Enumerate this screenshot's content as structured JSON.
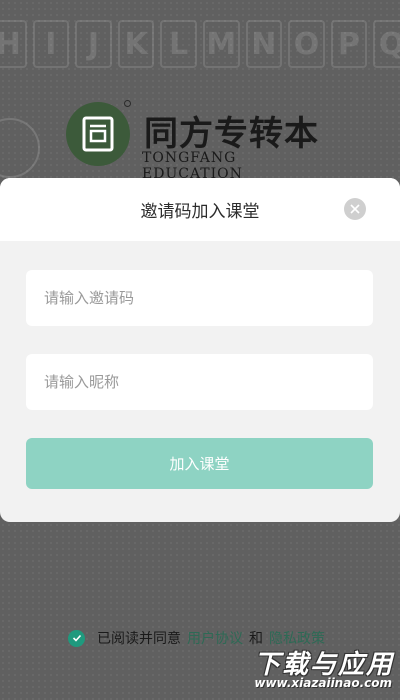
{
  "background": {
    "letters": [
      "H",
      "I",
      "J",
      "K",
      "L",
      "M",
      "N",
      "O",
      "P",
      "Q"
    ]
  },
  "brand": {
    "name_cn": "同方专转本",
    "name_en": "TONGFANG EDUCATION",
    "logo_glyph": "同",
    "logo_color": "#3c5a3a"
  },
  "dialog": {
    "title": "邀请码加入课堂",
    "code_placeholder": "请输入邀请码",
    "code_value": "",
    "nickname_placeholder": "请输入昵称",
    "nickname_value": "",
    "join_label": "加入课堂",
    "join_color": "#8ed3c3",
    "close_icon": "close-icon"
  },
  "agreement": {
    "prefix": "已阅读并同意",
    "user_agreement": "用户协议",
    "and": "和",
    "privacy_policy": "隐私政策",
    "checked": true,
    "check_color": "#1f9a7e"
  },
  "watermark": {
    "main": "下载与应用",
    "sub": "www.xiazaiinao.com"
  }
}
